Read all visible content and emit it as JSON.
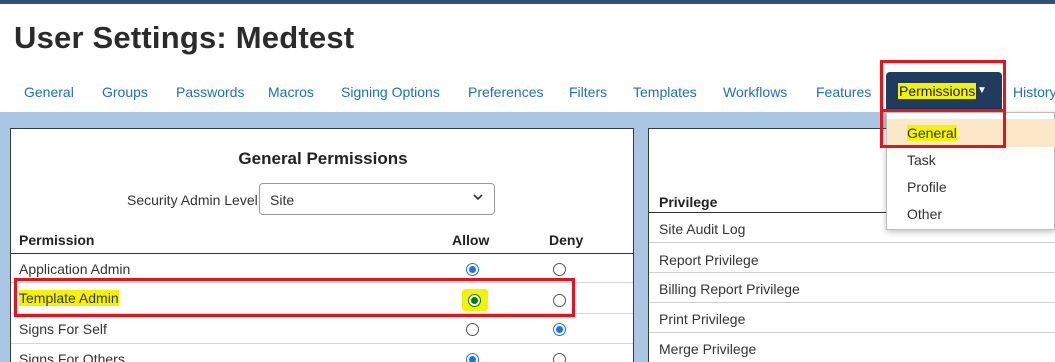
{
  "page": {
    "title": "User Settings: Medtest"
  },
  "tabs": [
    {
      "label": "General"
    },
    {
      "label": "Groups"
    },
    {
      "label": "Passwords"
    },
    {
      "label": "Macros"
    },
    {
      "label": "Signing Options"
    },
    {
      "label": "Preferences"
    },
    {
      "label": "Filters"
    },
    {
      "label": "Templates"
    },
    {
      "label": "Workflows"
    },
    {
      "label": "Features"
    },
    {
      "label": "Permissions",
      "active": true
    },
    {
      "label": "History"
    }
  ],
  "permissions_menu": {
    "items": [
      {
        "label": "General",
        "selected": true
      },
      {
        "label": "Task"
      },
      {
        "label": "Profile"
      },
      {
        "label": "Other"
      }
    ]
  },
  "general_permissions": {
    "title": "General Permissions",
    "security_label": "Security Admin Level:",
    "security_value": "Site",
    "headers": {
      "permission": "Permission",
      "allow": "Allow",
      "deny": "Deny"
    },
    "rows": [
      {
        "name": "Application Admin",
        "allow": true,
        "deny": false
      },
      {
        "name": "Template Admin",
        "allow": true,
        "deny": false,
        "highlighted": true
      },
      {
        "name": "Signs For Self",
        "allow": false,
        "deny": true
      },
      {
        "name": "Signs For Others",
        "allow": true,
        "deny": false
      }
    ]
  },
  "privileges": {
    "header": "Privilege",
    "items": [
      "Site Audit Log",
      "Report Privilege",
      "Billing Report Privilege",
      "Print Privilege",
      "Merge Privilege"
    ]
  },
  "colors": {
    "accent": "#1e6fb5",
    "band": "#a9c6e4",
    "highlight": "#f3f300",
    "annotation": "#e3141c",
    "active_tab": "#1f3b5d"
  },
  "icons": {
    "select_chevron": "chevron-down-icon",
    "tab_caret": "caret-down-icon"
  }
}
